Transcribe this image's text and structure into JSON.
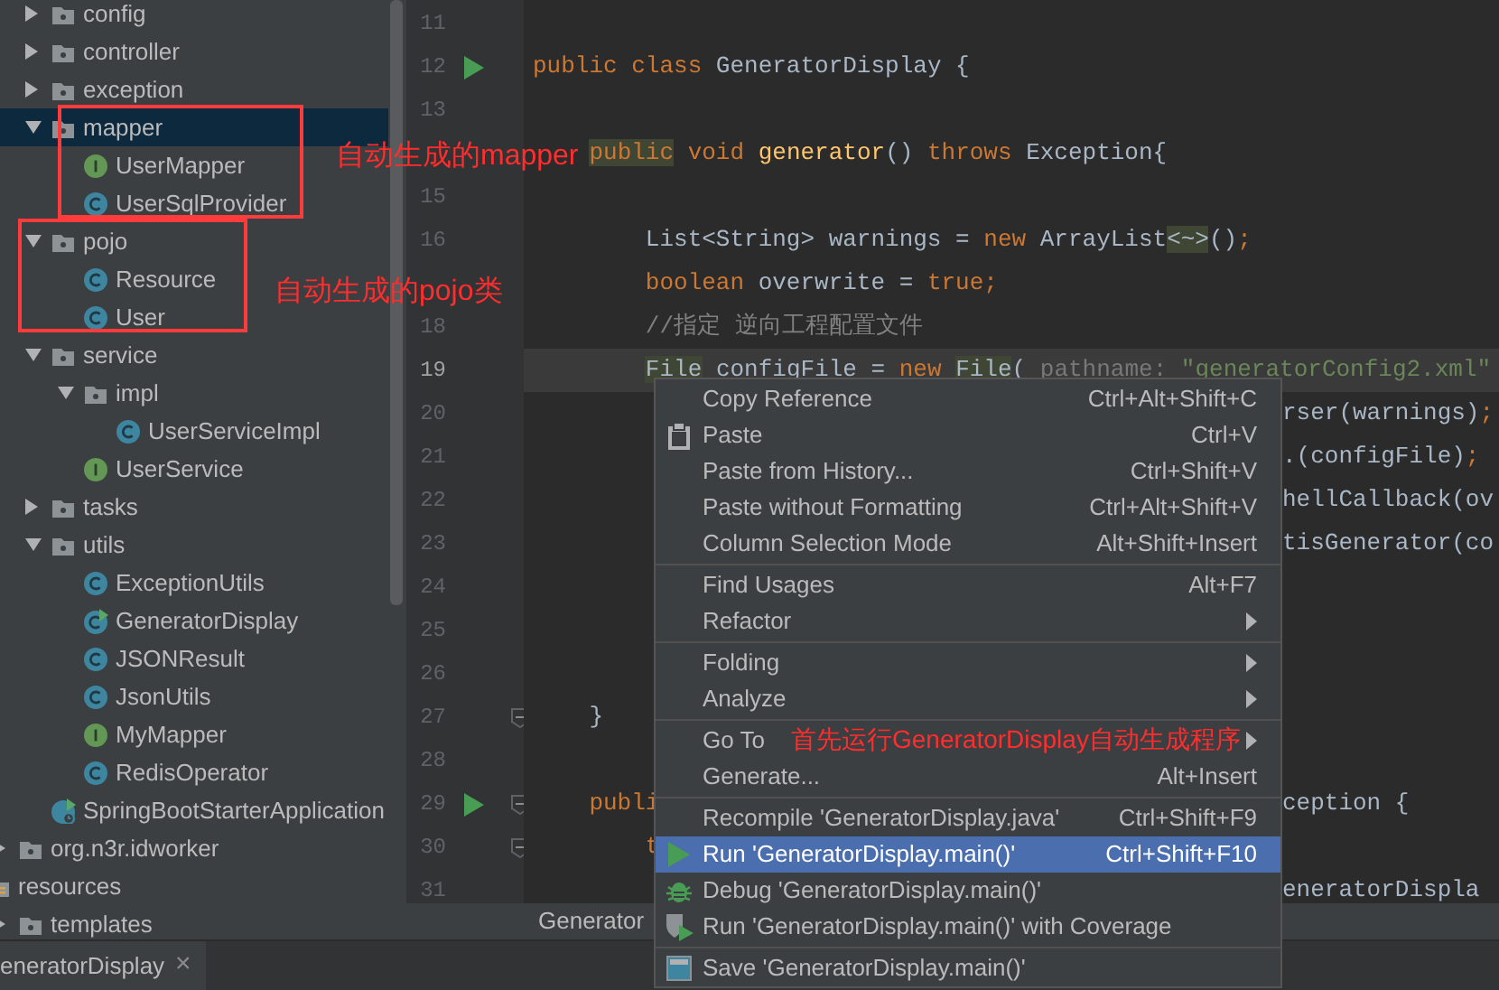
{
  "project_tree": [
    {
      "children": [
        {
          "children": [
            {
              "label": "config",
              "kind": "folder",
              "expanded": false,
              "selected": false
            },
            {
              "label": "controller",
              "kind": "folder",
              "expanded": false,
              "selected": false
            },
            {
              "label": "exception",
              "kind": "folder",
              "expanded": false,
              "selected": false
            },
            {
              "label": "mapper",
              "kind": "folder",
              "expanded": true,
              "selected": true,
              "children": [
                {
                  "label": "UserMapper",
                  "kind": "interface",
                  "selected": false
                },
                {
                  "label": "UserSqlProvider",
                  "kind": "class",
                  "selected": false
                }
              ]
            },
            {
              "label": "pojo",
              "kind": "folder",
              "expanded": true,
              "selected": false,
              "children": [
                {
                  "label": "Resource",
                  "kind": "class",
                  "selected": false
                },
                {
                  "label": "User",
                  "kind": "class",
                  "selected": false
                }
              ]
            },
            {
              "label": "service",
              "kind": "folder",
              "expanded": true,
              "selected": false,
              "children": [
                {
                  "label": "impl",
                  "kind": "folder",
                  "expanded": true,
                  "selected": false,
                  "children": [
                    {
                      "label": "UserServiceImpl",
                      "kind": "class",
                      "selected": false
                    }
                  ]
                },
                {
                  "label": "UserService",
                  "kind": "interface",
                  "selected": false
                }
              ]
            },
            {
              "label": "tasks",
              "kind": "folder",
              "expanded": false,
              "selected": false
            },
            {
              "label": "utils",
              "kind": "folder",
              "expanded": true,
              "selected": false,
              "children": [
                {
                  "label": "ExceptionUtils",
                  "kind": "class",
                  "selected": false
                },
                {
                  "label": "GeneratorDisplay",
                  "kind": "runnable",
                  "selected": false
                },
                {
                  "label": "JSONResult",
                  "kind": "class",
                  "selected": false
                },
                {
                  "label": "JsonUtils",
                  "kind": "class",
                  "selected": false
                },
                {
                  "label": "MyMapper",
                  "kind": "interface",
                  "selected": false
                },
                {
                  "label": "RedisOperator",
                  "kind": "class",
                  "selected": false
                }
              ]
            },
            {
              "label": "SpringBootStarterApplication",
              "kind": "spring-app",
              "selected": false
            }
          ]
        },
        {
          "label": "org.n3r.idworker",
          "kind": "folder",
          "expanded": false,
          "selected": false
        }
      ]
    },
    {
      "label": "resources",
      "kind": "resources",
      "selected": false,
      "children": [
        {
          "label": "templates",
          "kind": "folder",
          "expanded": false,
          "selected": false
        }
      ]
    }
  ],
  "code_lines": [
    {
      "number": "11",
      "run_marker": false,
      "fold_marker": false
    },
    {
      "number": "12",
      "run_marker": true,
      "fold_marker": false,
      "segments": [
        {
          "text": "public class ",
          "kind": "keyword"
        },
        {
          "text": "GeneratorDisplay {",
          "kind": "plain"
        }
      ]
    },
    {
      "number": "13",
      "run_marker": false,
      "fold_marker": false
    },
    {
      "run_marker": false,
      "fold_marker": false,
      "segments": [
        {
          "text": "    public",
          "kind": "keyword",
          "highlighted": true
        },
        {
          "text": " void ",
          "kind": "keyword"
        },
        {
          "text": "generator",
          "kind": "method"
        },
        {
          "text": "() ",
          "kind": "plain"
        },
        {
          "text": "throws ",
          "kind": "keyword"
        },
        {
          "text": "Exception{",
          "kind": "plain"
        }
      ]
    },
    {
      "number": "15",
      "run_marker": false,
      "fold_marker": false
    },
    {
      "number": "16",
      "run_marker": false,
      "fold_marker": false,
      "segments": [
        {
          "text": "        List<String> warnings = ",
          "kind": "plain"
        },
        {
          "text": "new ",
          "kind": "keyword"
        },
        {
          "text": "ArrayList",
          "kind": "plain"
        },
        {
          "text": "<~>",
          "kind": "plain",
          "highlighted": true
        },
        {
          "text": "()",
          "kind": "plain"
        },
        {
          "text": ";",
          "kind": "keyword"
        }
      ]
    },
    {
      "run_marker": false,
      "fold_marker": false,
      "segments": [
        {
          "text": "        boolean ",
          "kind": "keyword"
        },
        {
          "text": "overwrite = ",
          "kind": "plain"
        },
        {
          "text": "true;",
          "kind": "keyword"
        }
      ]
    },
    {
      "number": "18",
      "run_marker": false,
      "fold_marker": false,
      "segments": [
        {
          "text": "        //指定 逆向工程配置文件",
          "kind": "comment"
        }
      ]
    },
    {
      "number": "19",
      "current": true,
      "run_marker": false,
      "fold_marker": false,
      "segments": [
        {
          "text": "        File",
          "kind": "plain",
          "highlighted": true
        },
        {
          "text": " configFile = ",
          "kind": "plain"
        },
        {
          "text": "new ",
          "kind": "keyword"
        },
        {
          "text": "File",
          "kind": "plain",
          "highlighted": true
        },
        {
          "text": "( ",
          "kind": "plain"
        },
        {
          "text": "pathname:",
          "kind": "hint"
        },
        {
          "text": " \"generatorConfig2.xml\"",
          "kind": "string"
        }
      ]
    },
    {
      "number": "20",
      "run_marker": false,
      "fold_marker": false,
      "right_segments": [
        {
          "text": "rser(warnings)",
          "kind": "plain"
        },
        {
          "text": ";",
          "kind": "keyword"
        }
      ]
    },
    {
      "number": "21",
      "run_marker": false,
      "fold_marker": false,
      "right_segments": [
        {
          "text": ".(configFile)",
          "kind": "plain"
        },
        {
          "text": ";",
          "kind": "keyword"
        }
      ]
    },
    {
      "number": "22",
      "run_marker": false,
      "fold_marker": false,
      "right_segments": [
        {
          "text": "hellCallback(ov",
          "kind": "plain"
        }
      ]
    },
    {
      "number": "23",
      "run_marker": false,
      "fold_marker": false,
      "right_segments": [
        {
          "text": "tisGenerator(co",
          "kind": "plain"
        }
      ]
    },
    {
      "number": "24",
      "run_marker": false,
      "fold_marker": false
    },
    {
      "number": "25",
      "run_marker": false,
      "fold_marker": false
    },
    {
      "number": "26",
      "run_marker": false,
      "fold_marker": false
    },
    {
      "number": "27",
      "run_marker": false,
      "fold_marker": true,
      "segments": [
        {
          "text": "    }",
          "kind": "plain"
        }
      ]
    },
    {
      "number": "28",
      "run_marker": false,
      "fold_marker": false
    },
    {
      "number": "29",
      "run_marker": true,
      "fold_marker": true,
      "segments": [
        {
          "text": "    publi",
          "kind": "keyword"
        }
      ],
      "right_segments": [
        {
          "text": "ception {",
          "kind": "plain"
        }
      ]
    },
    {
      "number": "30",
      "run_marker": false,
      "fold_marker": true,
      "segments": [
        {
          "text": "        t",
          "kind": "keyword"
        }
      ]
    },
    {
      "number": "31",
      "run_marker": false,
      "fold_marker": false,
      "right_segments": [
        {
          "text": "eneratorDispla",
          "kind": "plain"
        }
      ]
    }
  ],
  "breadcrumb": "Generator",
  "editor_tab": {
    "label": "eneratorDisplay",
    "close": "×"
  },
  "context_menu": [
    [
      {
        "label": "Copy Reference",
        "shortcut": "Ctrl+Alt+Shift+C",
        "kind": "plain",
        "selected": false
      },
      {
        "label": "Paste",
        "shortcut": "Ctrl+V",
        "kind": "paste",
        "selected": false
      },
      {
        "label": "Paste from History...",
        "shortcut": "Ctrl+Shift+V",
        "kind": "plain",
        "selected": false
      },
      {
        "label": "Paste without Formatting",
        "shortcut": "Ctrl+Alt+Shift+V",
        "kind": "plain",
        "selected": false
      },
      {
        "label": "Column Selection Mode",
        "shortcut": "Alt+Shift+Insert",
        "kind": "plain",
        "selected": false
      }
    ],
    [
      {
        "label": "Find Usages",
        "shortcut": "Alt+F7",
        "kind": "plain",
        "selected": false
      },
      {
        "label": "Refactor",
        "submenu": true,
        "kind": "plain",
        "selected": false
      }
    ],
    [
      {
        "label": "Folding",
        "submenu": true,
        "kind": "plain",
        "selected": false
      },
      {
        "label": "Analyze",
        "submenu": true,
        "kind": "plain",
        "selected": false
      }
    ],
    [
      {
        "label": "Go To",
        "submenu": true,
        "kind": "plain",
        "selected": false
      },
      {
        "label": "Generate...",
        "shortcut": "Alt+Insert",
        "kind": "plain",
        "selected": false
      }
    ],
    [
      {
        "label": "Recompile 'GeneratorDisplay.java'",
        "shortcut": "Ctrl+Shift+F9",
        "kind": "plain",
        "selected": false
      },
      {
        "label": "Run 'GeneratorDisplay.main()'",
        "shortcut": "Ctrl+Shift+F10",
        "kind": "run",
        "selected": true
      },
      {
        "label": "Debug 'GeneratorDisplay.main()'",
        "kind": "debug",
        "selected": false
      },
      {
        "label": "Run 'GeneratorDisplay.main()' with Coverage",
        "kind": "coverage",
        "selected": false
      }
    ],
    [
      {
        "label": "Save 'GeneratorDisplay.main()'",
        "kind": "save",
        "selected": false
      }
    ]
  ],
  "annotations": [
    {
      "text": "自动生成的mapper"
    },
    {
      "text": "自动生成的pojo类"
    },
    {
      "text": "首先运行GeneratorDisplay自动生成程序"
    }
  ]
}
